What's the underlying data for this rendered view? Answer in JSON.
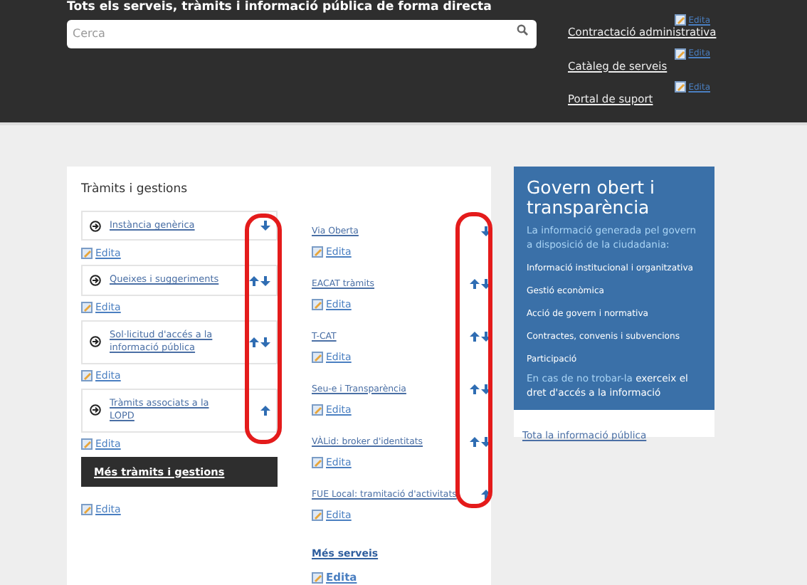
{
  "header": {
    "title": "Tots els serveis, tràmits i informació pública de forma directa",
    "search": {
      "placeholder": "Cerca"
    },
    "links": [
      {
        "label": "Contractació administrativa",
        "edit": "Edita"
      },
      {
        "label": "Catàleg de serveis",
        "edit": "Edita"
      },
      {
        "label": "Portal de suport",
        "edit": "Edita"
      }
    ]
  },
  "procedures": {
    "title": "Tràmits i gestions",
    "items": [
      {
        "label": "Instància genèrica",
        "up": false,
        "down": true,
        "edit": "Edita"
      },
      {
        "label": "Queixes i suggeriments",
        "up": true,
        "down": true,
        "edit": "Edita"
      },
      {
        "label": "Sol·licitud d'accés a la informació pública",
        "up": true,
        "down": true,
        "edit": "Edita"
      },
      {
        "label": "Tràmits associats a la LOPD",
        "up": true,
        "down": false,
        "edit": "Edita"
      }
    ],
    "more": "Més tràmits i gestions",
    "more_edit": "Edita"
  },
  "services": {
    "items": [
      {
        "label": "Via Oberta",
        "up": false,
        "down": true,
        "edit": "Edita"
      },
      {
        "label": "EACAT tràmits",
        "up": true,
        "down": true,
        "edit": "Edita"
      },
      {
        "label": "T-CAT",
        "up": true,
        "down": true,
        "edit": "Edita"
      },
      {
        "label": "Seu-e i Transparència",
        "up": true,
        "down": true,
        "edit": "Edita"
      },
      {
        "label": "VÀLid: broker d'identitats",
        "up": true,
        "down": true,
        "edit": "Edita"
      },
      {
        "label": "FUE Local: tramitació d'activitats",
        "up": true,
        "down": false,
        "edit": "Edita"
      }
    ],
    "more": "Més serveis",
    "more_edit": "Edita"
  },
  "transparency": {
    "title": "Govern obert i transparència",
    "intro": "La informació generada pel govern a disposició de la ciudadania:",
    "links": [
      "Informació institucional i organitzativa",
      "Gestió econòmica",
      "Acció de govern i normativa",
      "Contractes, convenis i subvencions",
      "Participació"
    ],
    "note": "En cas de no trobar-la **exerceix el dret d'accés a la informació**",
    "footer_link": "Tota la informació pública"
  }
}
